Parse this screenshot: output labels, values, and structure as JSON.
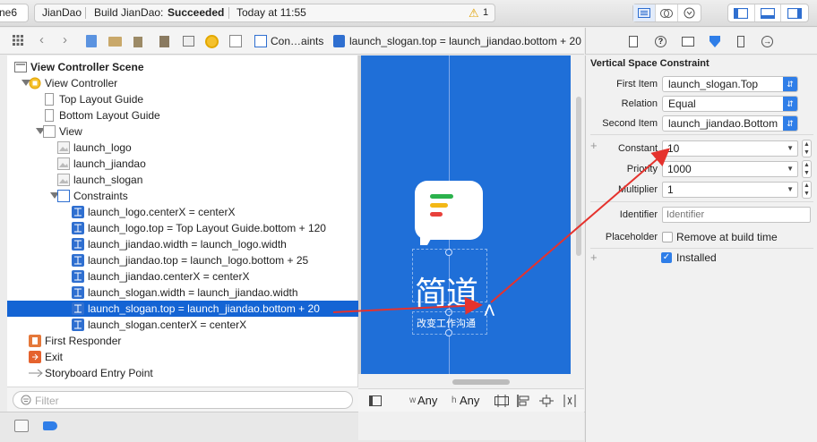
{
  "toolbar": {
    "scheme_tail": "ne6",
    "project": "JianDao",
    "build_prefix": "Build JianDao: ",
    "build_status": "Succeeded",
    "time": "Today at 11:55",
    "warning_count": "1"
  },
  "jumpbar": {
    "crumb_constraints": "Con…aints",
    "crumb_current": "launch_slogan.top = launch_jiandao.bottom + 20"
  },
  "outline": {
    "scene": "View Controller Scene",
    "vc": "View Controller",
    "top_guide": "Top Layout Guide",
    "bottom_guide": "Bottom Layout Guide",
    "view": "View",
    "views": [
      "launch_logo",
      "launch_jiandao",
      "launch_slogan"
    ],
    "constraints_label": "Constraints",
    "constraints": [
      "launch_logo.centerX = centerX",
      "launch_logo.top = Top Layout Guide.bottom + 120",
      "launch_jiandao.width = launch_logo.width",
      "launch_jiandao.top = launch_logo.bottom + 25",
      "launch_jiandao.centerX = centerX",
      "launch_slogan.width = launch_jiandao.width",
      "launch_slogan.top = launch_jiandao.bottom + 20",
      "launch_slogan.centerX = centerX"
    ],
    "first_responder": "First Responder",
    "exit": "Exit",
    "entry_point": "Storyboard Entry Point",
    "filter_placeholder": "Filter"
  },
  "canvas": {
    "app_title": "简道",
    "slogan": "改变工作沟通",
    "size_w_prefix": "w",
    "size_w": "Any",
    "size_h_prefix": "h",
    "size_h": "Any"
  },
  "inspector": {
    "title": "Vertical Space Constraint",
    "first_item_label": "First Item",
    "first_item": "launch_slogan.Top",
    "relation_label": "Relation",
    "relation": "Equal",
    "second_item_label": "Second Item",
    "second_item": "launch_jiandao.Bottom",
    "constant_label": "Constant",
    "constant": "10",
    "priority_label": "Priority",
    "priority": "1000",
    "multiplier_label": "Multiplier",
    "multiplier": "1",
    "identifier_label": "Identifier",
    "identifier_placeholder": "Identifier",
    "placeholder_label": "Placeholder",
    "remove_label": "Remove at build time",
    "installed_label": "Installed",
    "installed_checked": true,
    "remove_checked": false
  },
  "colors": {
    "selection": "#1464d4",
    "canvas_bg": "#1f6fd8",
    "arrow": "#e5322d",
    "accent": "#2f7ee8"
  }
}
